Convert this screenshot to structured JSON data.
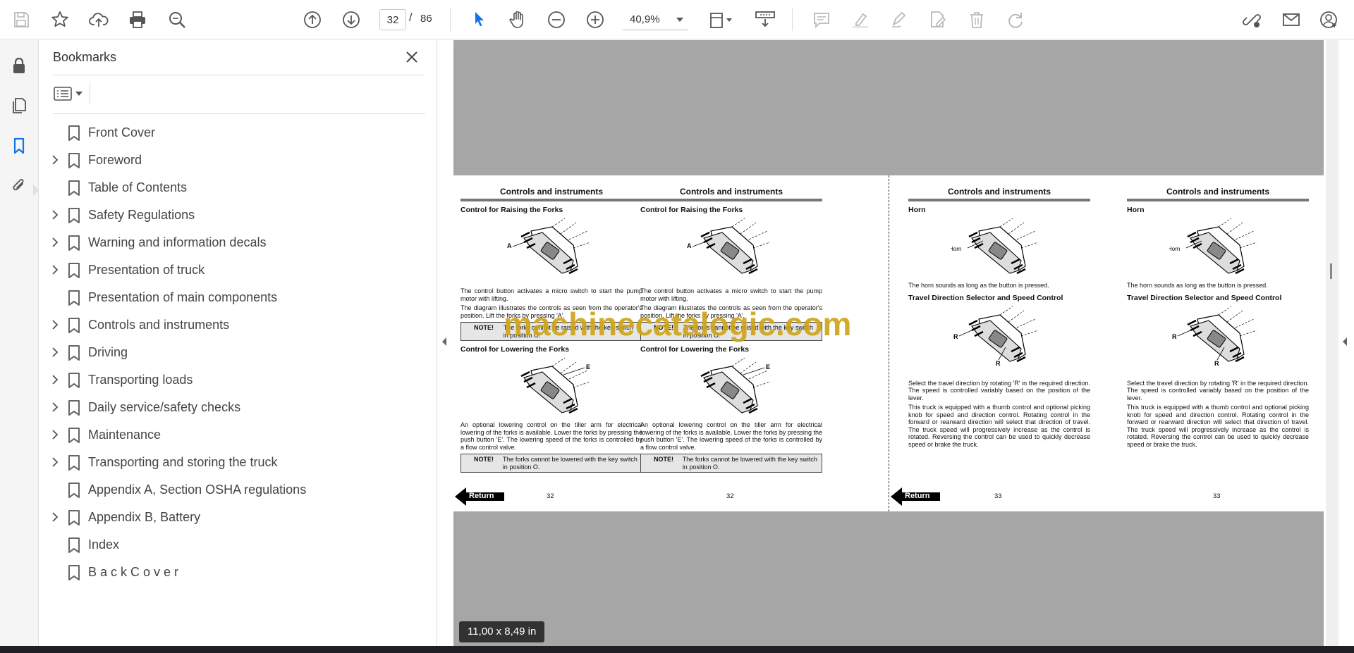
{
  "toolbar": {
    "current_page": "32",
    "page_separator": "/",
    "total_pages": "86",
    "zoom": "40,9%",
    "icons": [
      "save-icon",
      "bookmark-star-icon",
      "upload-icon",
      "print-icon",
      "search-zoom-icon",
      "page-up-icon",
      "page-down-icon",
      "select-cursor-icon",
      "hand-tool-icon",
      "zoom-out-icon",
      "zoom-in-icon",
      "zoom-dropdown-icon",
      "fit-page-icon",
      "scroll-mode-icon",
      "comment-icon",
      "highlight-icon",
      "draw-icon",
      "edit-text-icon",
      "delete-icon",
      "redo-icon",
      "share-link-icon",
      "email-icon",
      "account-icon"
    ]
  },
  "bookmarks": {
    "title": "Bookmarks",
    "items": [
      {
        "label": "Front Cover",
        "expandable": false
      },
      {
        "label": "Foreword",
        "expandable": true
      },
      {
        "label": "Table of Contents",
        "expandable": false
      },
      {
        "label": "Safety Regulations",
        "expandable": true
      },
      {
        "label": "Warning and information decals",
        "expandable": true
      },
      {
        "label": "Presentation of truck",
        "expandable": true
      },
      {
        "label": "Presentation of main components",
        "expandable": false
      },
      {
        "label": "Controls and instruments",
        "expandable": true
      },
      {
        "label": "Driving",
        "expandable": true
      },
      {
        "label": "Transporting loads",
        "expandable": true
      },
      {
        "label": "Daily service/safety checks",
        "expandable": true
      },
      {
        "label": "Maintenance",
        "expandable": true
      },
      {
        "label": "Transporting and storing the truck",
        "expandable": true
      },
      {
        "label": "Appendix A, Section OSHA regulations",
        "expandable": false
      },
      {
        "label": "Appendix B, Battery",
        "expandable": true
      },
      {
        "label": "Index",
        "expandable": false
      },
      {
        "label": "B a c k C o v e r",
        "expandable": false
      }
    ]
  },
  "document": {
    "watermark": "machinecatalogic.com",
    "page_size": "11,00 x 8,49 in",
    "return_label": "Return",
    "left_pages": [
      {
        "header": "Controls and instruments",
        "raise_title": "Control for Raising the Forks",
        "raise_label_a": "A",
        "raise_p1": "The control button activates a micro switch to start the pump motor with lifting.",
        "raise_p2": "The diagram illustrates the controls as seen from the operator's position. Lift the forks by pressing 'A'.",
        "note1_label": "NOTE!",
        "note1_text": "The forks cannot be raised with the key switch in position O.",
        "lower_title": "Control for Lowering the Forks",
        "lower_label_e": "E",
        "lower_p": "An optional lowering control on the tiller arm for electrical lowering of the forks is available. Lower the forks by pressing the push button 'E'. The lowering speed of the forks is controlled by a flow control valve.",
        "note2_label": "NOTE!",
        "note2_text": "The forks cannot be lowered with the key switch in position O.",
        "page_num": "32"
      },
      {
        "header": "Controls and instruments",
        "raise_title": "Control for Raising the Forks",
        "raise_label_a": "A",
        "raise_p1": "The control button activates a micro switch to start the pump motor with lifting.",
        "raise_p2": "The diagram illustrates the controls as seen from the operator's position. Lift the forks by pressing 'A'.",
        "note1_label": "NOTE!",
        "note1_text": "The forks cannot be raised with the key switch in position O.",
        "lower_title": "Control for Lowering the Forks",
        "lower_label_e": "E",
        "lower_p": "An optional lowering control on the tiller arm for electrical lowering of the forks is available. Lower the forks by pressing the push button 'E'. The lowering speed of the forks is controlled by a flow control valve.",
        "note2_label": "NOTE!",
        "note2_text": "The forks cannot be lowered with the key switch in position O.",
        "page_num": "32"
      }
    ],
    "right_pages": [
      {
        "header": "Controls and instruments",
        "horn_title": "Horn",
        "horn_label": "Horn",
        "horn_p": "The horn sounds as long as the button is pressed.",
        "travel_title": "Travel Direction Selector and Speed Control",
        "travel_label_r": "R",
        "travel_p1": "Select the travel direction by rotating 'R' in the required direction. The speed is controlled variably based on the position of the lever.",
        "travel_p2": "This truck is equipped with a thumb control and optional picking knob for speed and direction control. Rotating control in the forward or rearward direction will select that direction of travel. The truck speed will progressively increase as the control is rotated. Reversing the control can be used to quickly decrease speed or brake the truck.",
        "page_num": "33"
      },
      {
        "header": "Controls and instruments",
        "horn_title": "Horn",
        "horn_label": "Horn",
        "horn_p": "The horn sounds as long as the button is pressed.",
        "travel_title": "Travel Direction Selector and Speed Control",
        "travel_label_r": "R",
        "travel_p1": "Select the travel direction by rotating 'R' in the required direction. The speed is controlled variably based on the position of the lever.",
        "travel_p2": "This truck is equipped with a thumb control and optional picking knob for speed and direction control. Rotating control in the forward or rearward direction will select that direction of travel. The truck speed will progressively increase as the control is rotated. Reversing the control can be used to quickly decrease speed or brake the truck.",
        "page_num": "33"
      }
    ]
  },
  "colors": {
    "accent": "#1473e6",
    "canvas": "#a6a6a6",
    "watermark": "#d0a418"
  }
}
